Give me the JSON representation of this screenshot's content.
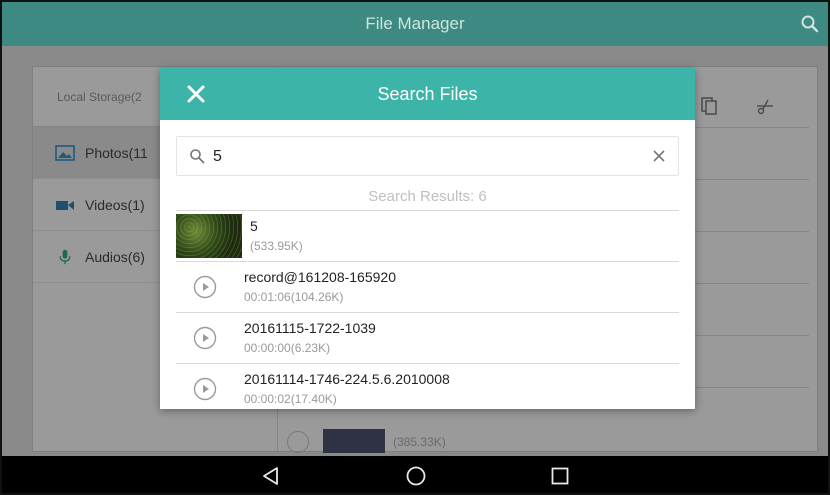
{
  "app": {
    "title": "File Manager"
  },
  "icons": {
    "search": "search-icon",
    "close": "close-icon",
    "clear": "clear-icon",
    "play": "play-circle-icon",
    "back": "back-triangle-icon",
    "home": "home-circle-icon",
    "recents": "recents-square-icon"
  },
  "colors": {
    "topbar": "#3c8a81",
    "dialog_header": "#3cb4a8"
  },
  "background": {
    "sidebar_header": "Local Storage(2",
    "sidebar_items": [
      {
        "label": "Photos(11",
        "icon": "photo-icon"
      },
      {
        "label": "Videos(1)",
        "icon": "video-icon"
      },
      {
        "label": "Audios(6)",
        "icon": "microphone-icon"
      }
    ],
    "toolbar_icons": [
      "copy-icon",
      "cut-icon"
    ],
    "partial_row_meta": "(385.33K)"
  },
  "dialog": {
    "title": "Search Files",
    "search": {
      "value": "5"
    },
    "results_label": "Search Results: 6",
    "results": [
      {
        "type": "image",
        "name": "5",
        "meta": "(533.95K)"
      },
      {
        "type": "audio",
        "name": "record@161208-165920",
        "meta": "00:01:06(104.26K)"
      },
      {
        "type": "audio",
        "name": "20161115-1722-1039",
        "meta": "00:00:00(6.23K)"
      },
      {
        "type": "audio",
        "name": "20161114-1746-224.5.6.2010008",
        "meta": "00:00:02(17.40K)"
      }
    ]
  }
}
